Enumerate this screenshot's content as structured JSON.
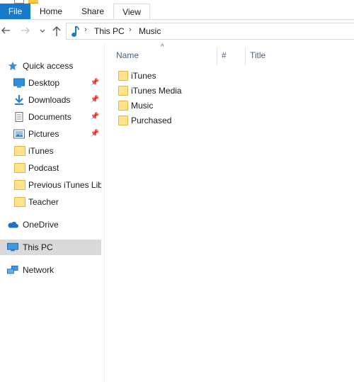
{
  "ribbon": {
    "tabs": [
      "File",
      "Home",
      "Share",
      "View"
    ]
  },
  "address": {
    "crumbs": [
      "This PC",
      "Music"
    ]
  },
  "nav_pane": {
    "quick_access": "Quick access",
    "items": [
      {
        "label": "Desktop",
        "icon": "desktop-icon",
        "pinned": true
      },
      {
        "label": "Downloads",
        "icon": "download-icon",
        "pinned": true
      },
      {
        "label": "Documents",
        "icon": "documents-icon",
        "pinned": true
      },
      {
        "label": "Pictures",
        "icon": "pictures-icon",
        "pinned": true
      },
      {
        "label": "iTunes",
        "icon": "folder-icon",
        "pinned": false
      },
      {
        "label": "Podcast",
        "icon": "folder-icon",
        "pinned": false
      },
      {
        "label": "Previous iTunes Lib",
        "icon": "folder-icon",
        "pinned": false
      },
      {
        "label": "Teacher",
        "icon": "folder-icon",
        "pinned": false
      }
    ],
    "onedrive": "OneDrive",
    "this_pc": "This PC",
    "network": "Network"
  },
  "file_list": {
    "columns": [
      "Name",
      "#",
      "Title"
    ],
    "rows": [
      "iTunes",
      "iTunes Media",
      "Music",
      "Purchased"
    ]
  },
  "colors": {
    "accent": "#1979ca",
    "selected_bg": "#d9d9d9",
    "folder": "#ffe28a"
  }
}
